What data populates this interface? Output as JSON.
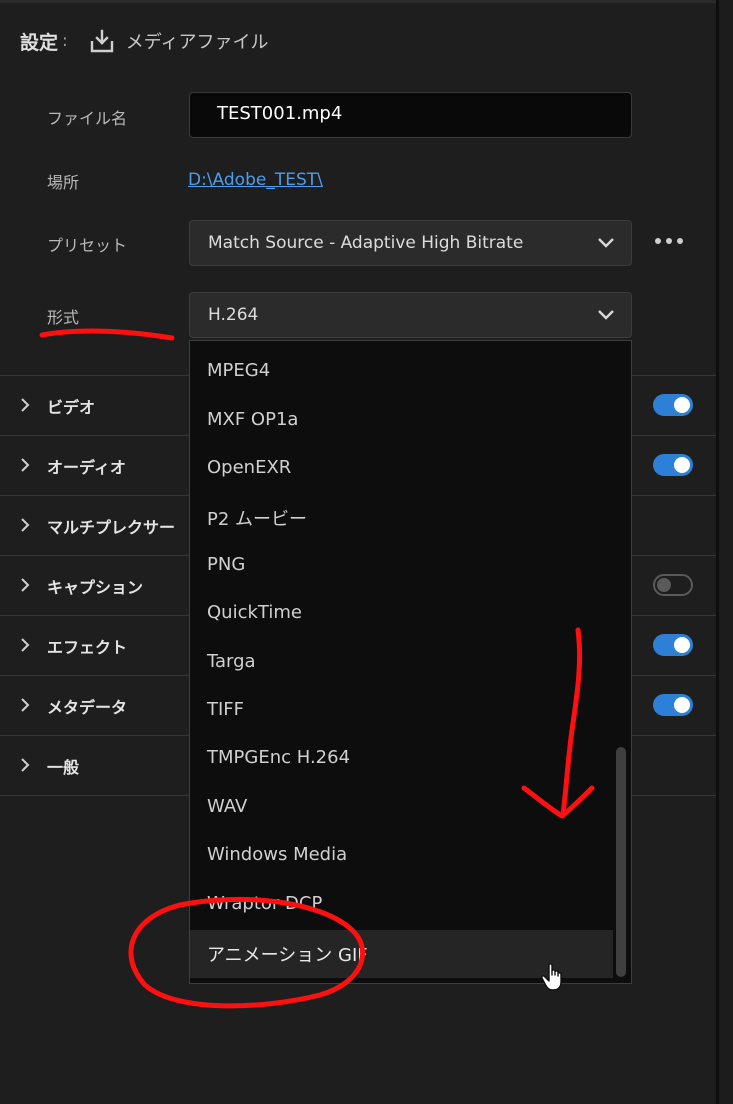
{
  "header": {
    "label": "設定",
    "colon": ":",
    "type_icon": "download-tray-icon",
    "value": "メディアファイル"
  },
  "form": {
    "filename_label": "ファイル名",
    "filename_value": "TEST001.mp4",
    "location_label": "場所",
    "location_value": "D:\\Adobe_TEST\\",
    "preset_label": "プリセット",
    "preset_value": "Match Source - Adaptive High Bitrate",
    "format_label": "形式",
    "format_value": "H.264"
  },
  "sections": [
    {
      "label": "ビデオ",
      "toggle": "on"
    },
    {
      "label": "オーディオ",
      "toggle": "on"
    },
    {
      "label": "マルチプレクサー",
      "toggle": null
    },
    {
      "label": "キャプション",
      "toggle": "off"
    },
    {
      "label": "エフェクト",
      "toggle": "on"
    },
    {
      "label": "メタデータ",
      "toggle": "on"
    },
    {
      "label": "一般",
      "toggle": null
    }
  ],
  "format_options": [
    "MPEG4",
    "MXF OP1a",
    "OpenEXR",
    "P2 ムービー",
    "PNG",
    "QuickTime",
    "Targa",
    "TIFF",
    "TMPGEnc H.264",
    "WAV",
    "Windows Media",
    "Wraptor DCP",
    "アニメーション GIF"
  ],
  "hovered_option": "アニメーション GIF",
  "colors": {
    "background": "#1e1e1e",
    "accent_toggle": "#2d7fd7",
    "link": "#4a9ef0",
    "annotation": "#ff1010"
  }
}
